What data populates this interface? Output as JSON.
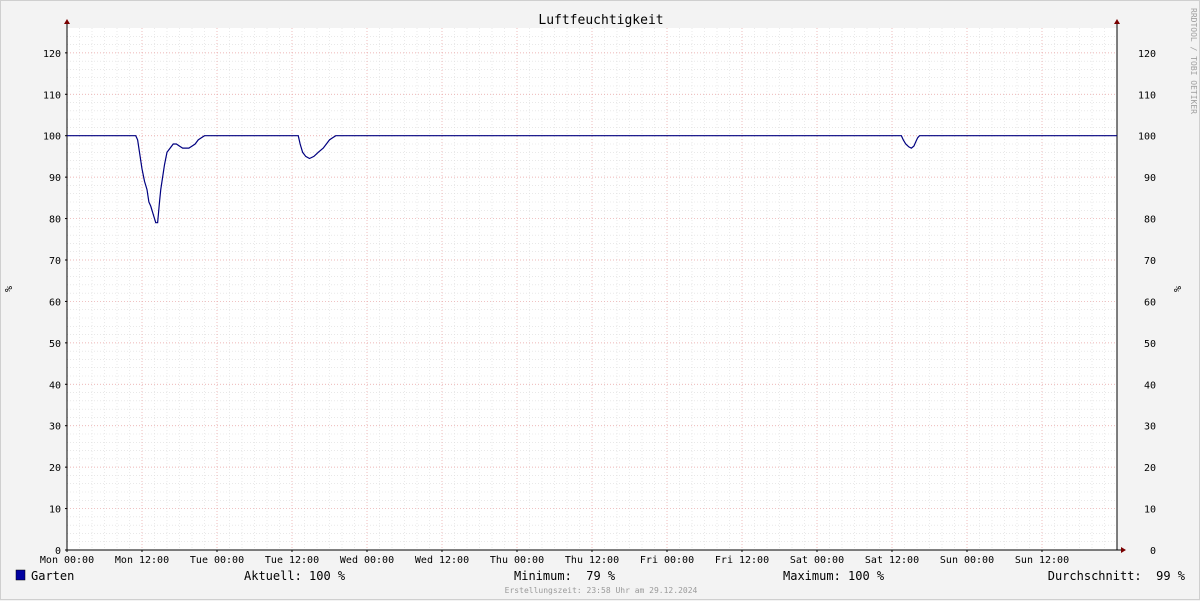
{
  "chart_data": {
    "type": "line",
    "title": "Luftfeuchtigkeit",
    "ylabel_left": "%",
    "ylabel_right": "%",
    "ylim": [
      0,
      126
    ],
    "yticks": [
      0,
      10,
      20,
      30,
      40,
      50,
      60,
      70,
      80,
      90,
      100,
      110,
      120
    ],
    "xlim": [
      0,
      168
    ],
    "x_unit": "hours since Mon 00:00",
    "xticks": [
      {
        "x": 0,
        "label": "Mon 00:00"
      },
      {
        "x": 12,
        "label": "Mon 12:00"
      },
      {
        "x": 24,
        "label": "Tue 00:00"
      },
      {
        "x": 36,
        "label": "Tue 12:00"
      },
      {
        "x": 48,
        "label": "Wed 00:00"
      },
      {
        "x": 60,
        "label": "Wed 12:00"
      },
      {
        "x": 72,
        "label": "Thu 00:00"
      },
      {
        "x": 84,
        "label": "Thu 12:00"
      },
      {
        "x": 96,
        "label": "Fri 00:00"
      },
      {
        "x": 108,
        "label": "Fri 12:00"
      },
      {
        "x": 120,
        "label": "Sat 00:00"
      },
      {
        "x": 132,
        "label": "Sat 12:00"
      },
      {
        "x": 144,
        "label": "Sun 00:00"
      },
      {
        "x": 156,
        "label": "Sun 12:00"
      }
    ],
    "grid": true,
    "series": [
      {
        "name": "Garten",
        "color": "#000080",
        "points": [
          [
            0,
            100
          ],
          [
            11,
            100
          ],
          [
            11.3,
            99
          ],
          [
            11.6,
            96
          ],
          [
            12,
            92
          ],
          [
            12.4,
            89
          ],
          [
            12.8,
            87
          ],
          [
            13.1,
            84
          ],
          [
            13.4,
            83
          ],
          [
            13.8,
            81
          ],
          [
            14.2,
            79
          ],
          [
            14.5,
            79
          ],
          [
            14.8,
            84
          ],
          [
            15,
            87
          ],
          [
            15.3,
            90
          ],
          [
            15.6,
            93
          ],
          [
            16,
            96
          ],
          [
            16.5,
            97
          ],
          [
            17,
            98
          ],
          [
            17.5,
            98
          ],
          [
            18,
            97.5
          ],
          [
            18.5,
            97
          ],
          [
            19,
            97
          ],
          [
            19.5,
            97
          ],
          [
            20,
            97.5
          ],
          [
            20.5,
            98
          ],
          [
            21,
            99
          ],
          [
            21.5,
            99.5
          ],
          [
            22,
            100
          ],
          [
            37,
            100
          ],
          [
            37.3,
            98
          ],
          [
            37.7,
            96
          ],
          [
            38.2,
            95
          ],
          [
            38.8,
            94.5
          ],
          [
            39.5,
            95
          ],
          [
            40.2,
            96
          ],
          [
            41,
            97
          ],
          [
            41.5,
            98
          ],
          [
            42,
            99
          ],
          [
            42.5,
            99.5
          ],
          [
            43,
            100
          ],
          [
            133.5,
            100
          ],
          [
            133.8,
            99
          ],
          [
            134.2,
            98
          ],
          [
            134.7,
            97.3
          ],
          [
            135.1,
            97
          ],
          [
            135.5,
            97.5
          ],
          [
            135.8,
            98.5
          ],
          [
            136.1,
            99.5
          ],
          [
            136.4,
            100
          ],
          [
            168,
            100
          ]
        ]
      }
    ]
  },
  "legend": {
    "series_name": "Garten",
    "swatch_color": "#0000a0",
    "aktuell": "Aktuell: 100 %",
    "minimum": "Minimum:  79 %",
    "maximum": "Maximum: 100 %",
    "durchschnitt": "Durchschnitt:  99 %"
  },
  "footer": "Erstellungszeit: 23:58 Uhr am 29.12.2024",
  "watermark": "RRDTOOL / TOBI OETIKER"
}
